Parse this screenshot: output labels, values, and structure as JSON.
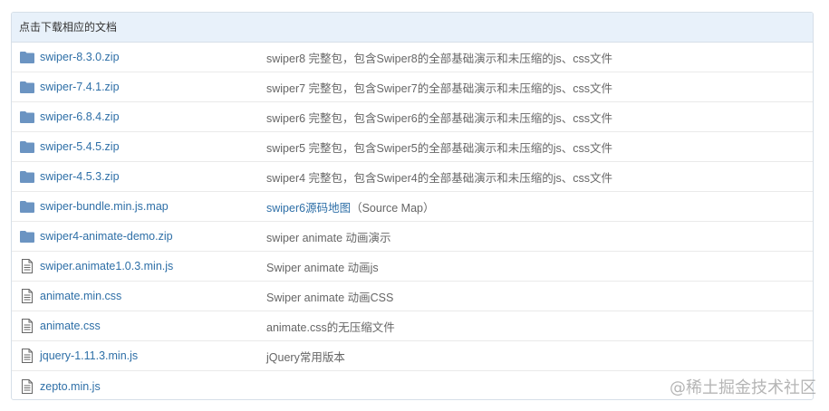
{
  "panel": {
    "title": "点击下载相应的文档"
  },
  "files": [
    {
      "icon": "folder-icon",
      "name": "swiper-8.3.0.zip",
      "desc": "swiper8 完整包，包含Swiper8的全部基础演示和未压缩的js、css文件"
    },
    {
      "icon": "folder-icon",
      "name": "swiper-7.4.1.zip",
      "desc": "swiper7 完整包，包含Swiper7的全部基础演示和未压缩的js、css文件"
    },
    {
      "icon": "folder-icon",
      "name": "swiper-6.8.4.zip",
      "desc": "swiper6 完整包，包含Swiper6的全部基础演示和未压缩的js、css文件"
    },
    {
      "icon": "folder-icon",
      "name": "swiper-5.4.5.zip",
      "desc": "swiper5 完整包，包含Swiper5的全部基础演示和未压缩的js、css文件"
    },
    {
      "icon": "folder-icon",
      "name": "swiper-4.5.3.zip",
      "desc": "swiper4 完整包，包含Swiper4的全部基础演示和未压缩的js、css文件"
    },
    {
      "icon": "folder-icon",
      "name": "swiper-bundle.min.js.map",
      "desc_link": "swiper6源码地图",
      "desc": "（Source Map）"
    },
    {
      "icon": "folder-icon",
      "name": "swiper4-animate-demo.zip",
      "desc": "swiper animate 动画演示"
    },
    {
      "icon": "file-icon",
      "name": "swiper.animate1.0.3.min.js",
      "desc": "Swiper animate 动画js"
    },
    {
      "icon": "file-icon",
      "name": "animate.min.css",
      "desc": "Swiper animate 动画CSS"
    },
    {
      "icon": "file-icon",
      "name": "animate.css",
      "desc": "animate.css的无压缩文件"
    },
    {
      "icon": "file-icon",
      "name": "jquery-1.11.3.min.js",
      "desc": "jQuery常用版本"
    },
    {
      "icon": "file-icon",
      "name": "zepto.min.js",
      "desc": ""
    }
  ],
  "watermark": "@稀土掘金技术社区",
  "colors": {
    "link": "#2e6fa7",
    "header_bg": "#e8f1fa",
    "folder": "#6b94c2"
  }
}
